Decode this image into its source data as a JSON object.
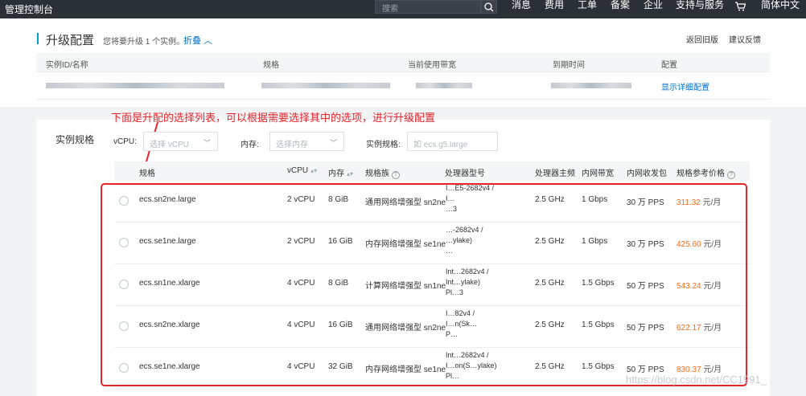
{
  "topbar": {
    "brand": "管理控制台",
    "search_placeholder": "搜索",
    "nav": [
      "消息",
      "费用",
      "工单",
      "备案",
      "企业",
      "支持与服务",
      "简体中文"
    ]
  },
  "header": {
    "title": "升级配置",
    "subtitle": "您将要升级 1 个实例。",
    "collapse_label": "折叠",
    "back_label": "返回旧版",
    "feedback_label": "建议反馈"
  },
  "instance_table": {
    "headers": [
      "实例ID/名称",
      "规格",
      "当前使用带宽",
      "到期时间",
      "配置"
    ],
    "detail_link": "显示详细配置"
  },
  "annotation": "下面是升配的选择列表，可以根据需要选择其中的选项，进行升级配置",
  "spec_filter": {
    "section_label": "实例规格",
    "vcpu_label": "vCPU:",
    "vcpu_placeholder": "选择 vCPU",
    "memory_label": "内存:",
    "memory_placeholder": "选择内存",
    "spec_label": "实例规格:",
    "spec_placeholder": "如 ecs.g5.large"
  },
  "spec_table": {
    "headers": {
      "spec": "规格",
      "vcpu": "vCPU",
      "memory": "内存",
      "family": "规格族",
      "cpu_model": "处理器型号",
      "freq": "处理器主频",
      "bandwidth": "内网带宽",
      "pps": "内网收发包",
      "price": "规格参考价格"
    },
    "rows": [
      {
        "spec": "ecs.sn2ne.large",
        "vcpu": "2 vCPU",
        "memory": "8 GiB",
        "family": "通用网络增强型 sn2ne",
        "cpu_lines": [
          "I…E5-2682v4 /",
          "I…",
          "…3"
        ],
        "freq": "2.5 GHz",
        "bandwidth": "1 Gbps",
        "pps": "30 万 PPS",
        "price": "311.32",
        "unit": "元/月"
      },
      {
        "spec": "ecs.se1ne.large",
        "vcpu": "2 vCPU",
        "memory": "16 GiB",
        "family": "内存网络增强型 se1ne",
        "cpu_lines": [
          "…-2682v4 /",
          "…ylake)",
          "…"
        ],
        "freq": "2.5 GHz",
        "bandwidth": "1 Gbps",
        "pps": "30 万 PPS",
        "price": "425.60",
        "unit": "元/月"
      },
      {
        "spec": "ecs.sn1ne.xlarge",
        "vcpu": "4 vCPU",
        "memory": "8 GiB",
        "family": "计算网络增强型 sn1ne",
        "cpu_lines": [
          "Int…2682v4 /",
          "Int…ylake)",
          "Pl…3"
        ],
        "freq": "2.5 GHz",
        "bandwidth": "1.5 Gbps",
        "pps": "50 万 PPS",
        "price": "543.24",
        "unit": "元/月"
      },
      {
        "spec": "ecs.sn2ne.xlarge",
        "vcpu": "4 vCPU",
        "memory": "16 GiB",
        "family": "通用网络增强型 sn2ne",
        "cpu_lines": [
          "I…82v4 /",
          "I…n(Sk…",
          "P…"
        ],
        "freq": "2.5 GHz",
        "bandwidth": "1.5 Gbps",
        "pps": "50 万 PPS",
        "price": "622.17",
        "unit": "元/月"
      },
      {
        "spec": "ecs.se1ne.xlarge",
        "vcpu": "4 vCPU",
        "memory": "32 GiB",
        "family": "内存网络增强型 se1ne",
        "cpu_lines": [
          "Int…2682v4 /",
          "I…on(S…ylake)",
          "Pl…"
        ],
        "freq": "2.5 GHz",
        "bandwidth": "1.5 Gbps",
        "pps": "50 万 PPS",
        "price": "830.37",
        "unit": "元/月"
      }
    ]
  },
  "watermark": "https://blog.csdn.net/CC1991_"
}
